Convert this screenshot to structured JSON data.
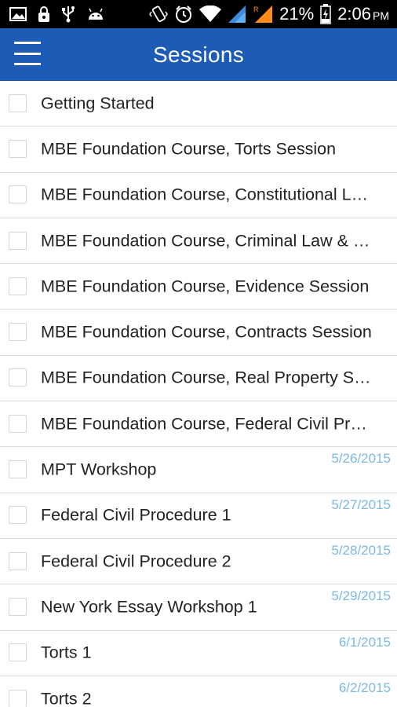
{
  "status_bar": {
    "battery_percent": "21%",
    "time": "2:06",
    "ampm": "PM",
    "icons": [
      "image-icon",
      "lock-icon",
      "usb-icon",
      "android-icon",
      "vibrate-icon",
      "alarm-icon",
      "wifi-icon",
      "signal-icon",
      "roaming-signal-icon",
      "battery-charging-icon"
    ]
  },
  "app_bar": {
    "title": "Sessions",
    "background": "#1c5cb6"
  },
  "sessions": [
    {
      "title": "Getting Started",
      "date": ""
    },
    {
      "title": "MBE Foundation Course, Torts Session",
      "date": ""
    },
    {
      "title": "MBE Foundation Course, Constitutional Law Session",
      "date": ""
    },
    {
      "title": "MBE Foundation Course, Criminal Law & Procedure Session",
      "date": ""
    },
    {
      "title": "MBE Foundation Course, Evidence Session",
      "date": ""
    },
    {
      "title": "MBE Foundation Course, Contracts Session",
      "date": ""
    },
    {
      "title": "MBE Foundation Course, Real Property Session",
      "date": ""
    },
    {
      "title": "MBE Foundation Course, Federal Civil Procedure Session",
      "date": ""
    },
    {
      "title": "MPT Workshop",
      "date": "5/26/2015"
    },
    {
      "title": "Federal Civil Procedure 1",
      "date": "5/27/2015"
    },
    {
      "title": "Federal Civil Procedure 2",
      "date": "5/28/2015"
    },
    {
      "title": "New York Essay Workshop 1",
      "date": "5/29/2015"
    },
    {
      "title": "Torts 1",
      "date": "6/1/2015"
    },
    {
      "title": "Torts 2",
      "date": "6/2/2015"
    }
  ]
}
